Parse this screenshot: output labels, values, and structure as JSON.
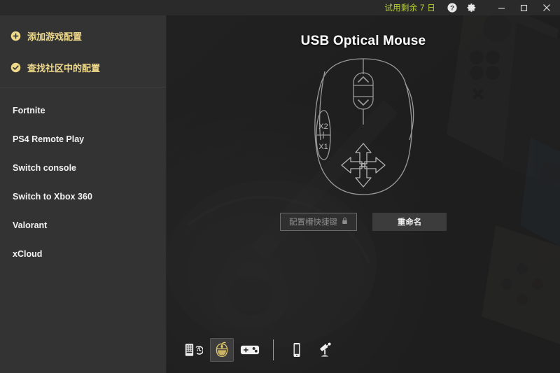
{
  "titlebar": {
    "trial_text": "试用剩余 7 日",
    "help_icon": "help-circle-icon",
    "settings_icon": "gear-icon",
    "minimize_label": "—",
    "maximize_label": "□",
    "close_label": "✕",
    "trial_color": "#b9d334"
  },
  "sidebar": {
    "actions": [
      {
        "label": "添加游戏配置",
        "icon": "plus-circle-icon"
      },
      {
        "label": "查找社区中的配置",
        "icon": "check-circle-icon"
      }
    ],
    "accent_color": "#efd98a",
    "profiles": [
      {
        "label": "Fortnite"
      },
      {
        "label": "PS4 Remote Play"
      },
      {
        "label": "Switch console"
      },
      {
        "label": "Switch to Xbox 360"
      },
      {
        "label": "Valorant"
      },
      {
        "label": "xCloud"
      }
    ]
  },
  "main": {
    "device_title": "USB Optical Mouse",
    "mouse_diagram": {
      "side_button_upper": "X2",
      "side_button_lower": "X1"
    },
    "buttons": {
      "shortcut": {
        "label": "配置槽快捷键",
        "lock_icon": "lock-icon",
        "disabled": true
      },
      "rename": {
        "label": "重命名",
        "disabled": false
      }
    }
  },
  "toolbar": {
    "items": [
      {
        "icon": "keyboard-help-icon",
        "selected": false
      },
      {
        "icon": "mouse-icon",
        "selected": true
      },
      {
        "icon": "gamepad-icon",
        "selected": false
      },
      {
        "icon": "separator",
        "selected": false
      },
      {
        "icon": "phone-icon",
        "selected": false
      },
      {
        "icon": "antenna-icon",
        "selected": false
      }
    ],
    "selected_color": "#e2c96a"
  }
}
